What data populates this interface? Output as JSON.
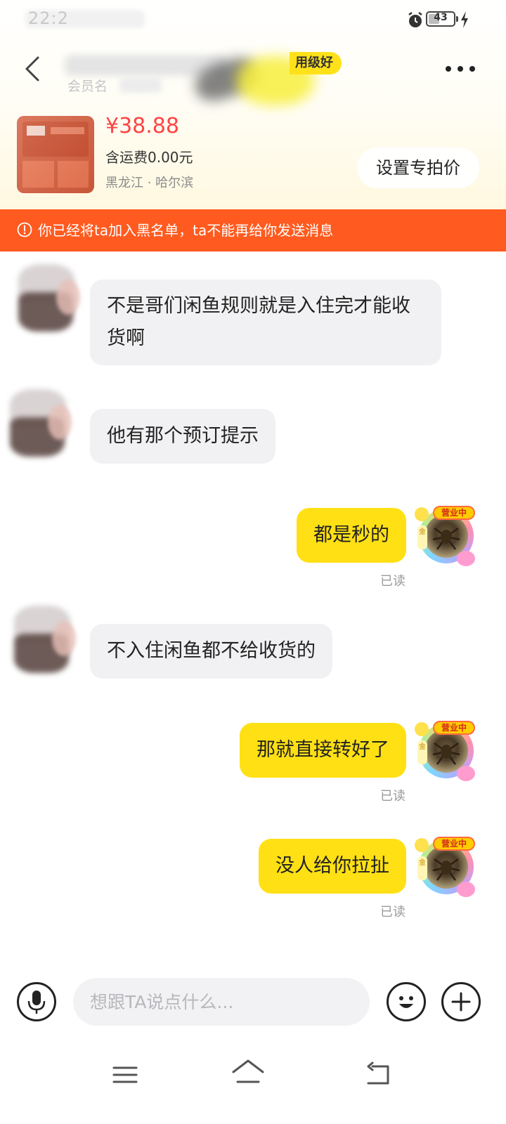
{
  "status_bar": {
    "time": "22:2",
    "battery_level": "43",
    "battery_fraction": 0.43
  },
  "header": {
    "member_label": "会员名",
    "credit_badge": "用级好"
  },
  "product": {
    "price": "¥38.88",
    "shipping": "含运费0.00元",
    "location": "黑龙江 · 哈尔滨",
    "set_price_button": "设置专拍价"
  },
  "blacklist_banner": {
    "text": "你已经将ta加入黑名单，ta不能再给你发送消息"
  },
  "messages": [
    {
      "side": "left",
      "text": "不是哥们闲鱼规则就是入住完才能收货啊"
    },
    {
      "side": "left",
      "text": "他有那个预订提示"
    },
    {
      "side": "right",
      "text": "都是秒的",
      "read": "已读"
    },
    {
      "side": "left",
      "text": "不入住闲鱼都不给收货的"
    },
    {
      "side": "right",
      "text": "那就直接转好了",
      "read": "已读"
    },
    {
      "side": "right",
      "text": "没人给你拉扯",
      "read": "已读"
    }
  ],
  "my_avatar": {
    "tag": "营业中",
    "side": "金"
  },
  "input_bar": {
    "placeholder": "想跟TA说点什么..."
  },
  "colors": {
    "accent_yellow": "#ffe014",
    "banner_orange": "#ff5a1f",
    "price_red": "#ff4444"
  },
  "icons": [
    "back-icon",
    "more-icon",
    "alarm-icon",
    "battery-icon",
    "charging-icon",
    "warning-icon",
    "microphone-icon",
    "emoji-icon",
    "plus-icon",
    "menu-icon",
    "home-icon",
    "back-nav-icon"
  ]
}
